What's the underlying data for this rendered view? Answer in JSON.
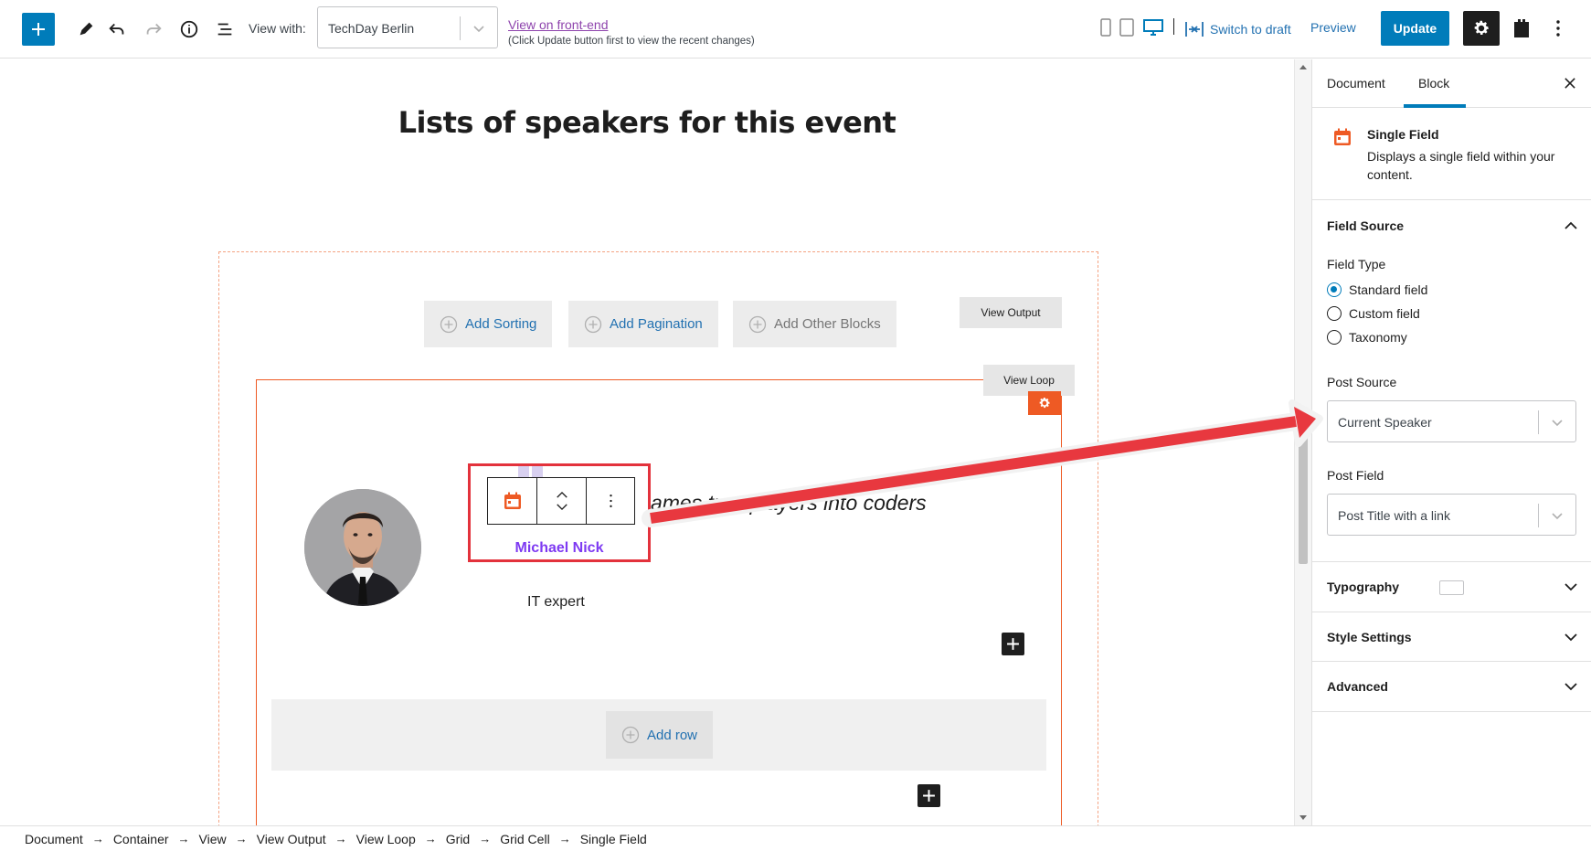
{
  "toolbar": {
    "view_with_label": "View with:",
    "view_with_value": "TechDay Berlin",
    "frontend_link": "View on front-end",
    "frontend_note": "(Click Update button first to view the recent changes)",
    "switch_to_draft": "Switch to draft",
    "preview": "Preview",
    "update": "Update"
  },
  "canvas": {
    "page_title": "Lists of speakers for this event",
    "add_sorting": "Add Sorting",
    "add_pagination": "Add Pagination",
    "add_other_blocks": "Add Other Blocks",
    "view_output": "View Output",
    "view_loop": "View Loop",
    "italic_text": "o games turn players into coders",
    "speaker_name": "Michael Nick",
    "speaker_role": "IT expert",
    "add_row": "Add row"
  },
  "sidebar": {
    "tabs": [
      "Document",
      "Block"
    ],
    "active_tab": "Block",
    "block": {
      "title": "Single Field",
      "description": "Displays a single field within your content."
    },
    "field_source": {
      "title": "Field Source",
      "field_type_label": "Field Type",
      "field_type_options": [
        "Standard field",
        "Custom field",
        "Taxonomy"
      ],
      "field_type_selected": "Standard field",
      "post_source_label": "Post Source",
      "post_source_value": "Current Speaker",
      "post_field_label": "Post Field",
      "post_field_value": "Post Title with a link"
    },
    "panels": [
      "Typography",
      "Style Settings",
      "Advanced"
    ]
  },
  "breadcrumb": [
    "Document",
    "Container",
    "View",
    "View Output",
    "View Loop",
    "Grid",
    "Grid Cell",
    "Single Field"
  ],
  "colors": {
    "accent": "#007cba",
    "toolset_orange": "#ee5a24",
    "highlight_red": "#e3323c",
    "speaker_name": "#7e3af2"
  },
  "icons": {
    "add": "plus-icon",
    "tools": "pencil-icon",
    "undo": "undo-icon",
    "redo": "redo-icon",
    "info": "info-icon",
    "outline": "list-view-icon",
    "settings": "gear-icon",
    "plugin": "toolset-icon",
    "more": "more-vertical-icon",
    "block": "calendar-field-icon"
  }
}
